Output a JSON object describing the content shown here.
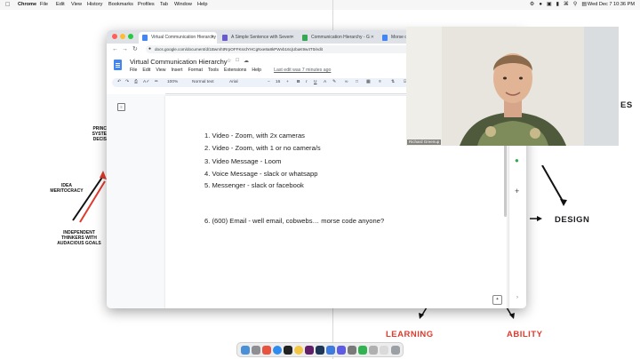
{
  "menubar": {
    "app": "Chrome",
    "items": [
      "File",
      "Edit",
      "View",
      "History",
      "Bookmarks",
      "Profiles",
      "Tab",
      "Window",
      "Help"
    ],
    "clock": "Wed Dec 7  10:36 PM"
  },
  "browser": {
    "tabs": [
      {
        "label": "Virtual Communication Hierarchy",
        "active": true,
        "color": "#4285f4"
      },
      {
        "label": "A Simple Sentence with Seven",
        "active": false,
        "color": "#6a5acd"
      },
      {
        "label": "Communication Hierarchy - G",
        "active": false,
        "color": "#34a853"
      },
      {
        "label": "Morse co",
        "active": false,
        "color": "#4285f4"
      }
    ],
    "url": "docs.google.com/document/d/1BwmhtRrpOFFKsrdYHCgNxe8a8kPWvb16cjUbaK9w4T0/edit"
  },
  "doc": {
    "title": "Virtual Communication Hierarchy",
    "menus": [
      "File",
      "Edit",
      "View",
      "Insert",
      "Format",
      "Tools",
      "Extensions",
      "Help"
    ],
    "last_edit": "Last edit was 7 minutes ago",
    "toolbar": {
      "zoom": "100%",
      "style": "Normal text",
      "font": "Arial",
      "size": "16"
    },
    "lines": [
      "1. Video - Zoom, with 2x cameras",
      "2. Video - Zoom, with 1 or no camera/s",
      "3. Video Message - Loom",
      "4. Voice Message - slack or whatsapp",
      "5. Messenger - slack or facebook",
      "6. (600) Email - well email, cobwebs… morse code anyone?"
    ]
  },
  "webcam": {
    "name": "Richard Greenup"
  },
  "slide": {
    "left_top": [
      "PRINC",
      "SYSTE",
      "DECIS"
    ],
    "idea": [
      "IDEA",
      "MERITOCRACY"
    ],
    "independent": [
      "INDEPENDENT",
      "THINKERS WITH",
      "AUDACIOUS GOALS"
    ],
    "design": "DESIGN",
    "right_top": "ES",
    "learning": "LEARNING",
    "ability": "ABILITY"
  },
  "colors": {
    "accent_red": "#e03a2c",
    "docs_blue": "#4285f4"
  }
}
